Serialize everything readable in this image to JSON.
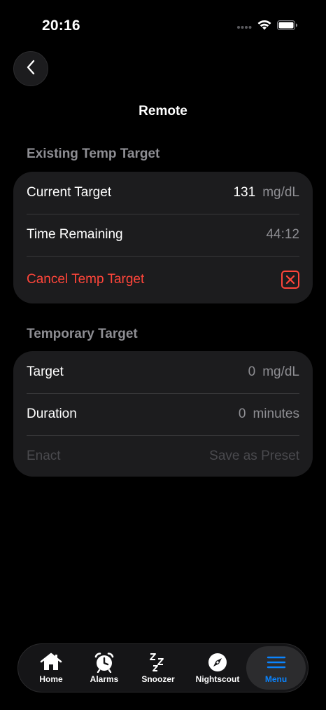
{
  "status_bar": {
    "time": "20:16"
  },
  "nav": {
    "title": "Remote"
  },
  "existing_section": {
    "header": "Existing Temp Target",
    "current_target_label": "Current Target",
    "current_target_value": "131",
    "current_target_unit": "mg/dL",
    "time_remaining_label": "Time Remaining",
    "time_remaining_value": "44:12",
    "cancel_label": "Cancel Temp Target"
  },
  "temporary_section": {
    "header": "Temporary Target",
    "target_label": "Target",
    "target_value": "0",
    "target_unit": "mg/dL",
    "duration_label": "Duration",
    "duration_value": "0",
    "duration_unit": "minutes",
    "enact_label": "Enact",
    "save_preset_label": "Save as Preset"
  },
  "tab_bar": {
    "items": [
      {
        "label": "Home",
        "icon": "home-icon"
      },
      {
        "label": "Alarms",
        "icon": "alarm-clock-icon"
      },
      {
        "label": "Snoozer",
        "icon": "zzz-icon"
      },
      {
        "label": "Nightscout",
        "icon": "compass-icon"
      },
      {
        "label": "Menu",
        "icon": "menu-icon"
      }
    ],
    "active_index": 4
  },
  "colors": {
    "accent": "#0a84ff",
    "destructive": "#ff453a",
    "card_background": "#1c1c1e",
    "secondary_text": "#8e8e93"
  }
}
